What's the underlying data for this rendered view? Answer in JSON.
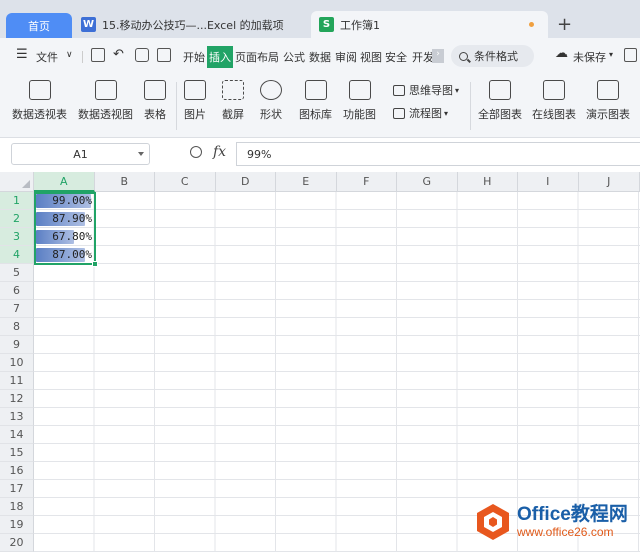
{
  "tabs": {
    "home": "首页",
    "doc": "15.移动办公技巧—...Excel 的加载项",
    "book": "工作簿1"
  },
  "menu": {
    "file": "文件",
    "start": "开始",
    "insert": "插入",
    "page_layout": "页面布局",
    "formula": "公式",
    "data": "数据",
    "review": "审阅",
    "view": "视图",
    "security": "安全",
    "dev": "开发",
    "search": "条件格式",
    "unsaved": "未保存"
  },
  "ribbon": {
    "pivot_table": "数据透视表",
    "pivot_chart": "数据透视图",
    "table": "表格",
    "picture": "图片",
    "screenshot": "截屏",
    "shape": "形状",
    "icon_lib": "图标库",
    "func_chart": "功能图",
    "mindmap": "思维导图",
    "flowchart": "流程图",
    "all_charts": "全部图表",
    "online_charts": "在线图表",
    "demo_charts": "演示图表"
  },
  "formula_bar": {
    "cell_ref": "A1",
    "fx": "fx",
    "value": "99%"
  },
  "columns": [
    "A",
    "B",
    "C",
    "D",
    "E",
    "F",
    "G",
    "H",
    "I",
    "J"
  ],
  "rows": [
    "1",
    "2",
    "3",
    "4",
    "5",
    "6",
    "7",
    "8",
    "9",
    "10",
    "11",
    "12",
    "13",
    "14",
    "15",
    "16",
    "17",
    "18",
    "19",
    "20"
  ],
  "cells": [
    {
      "text": "99.00%",
      "fraction": 0.99
    },
    {
      "text": "87.90%",
      "fraction": 0.879
    },
    {
      "text": "67.80%",
      "fraction": 0.678
    },
    {
      "text": "87.00%",
      "fraction": 0.87
    }
  ],
  "watermark": {
    "title": "Office教程网",
    "url": "www.office26.com"
  },
  "colors": {
    "accent": "#21a366",
    "home_tab": "#4f8df5",
    "databar": "#5b7fc4"
  }
}
